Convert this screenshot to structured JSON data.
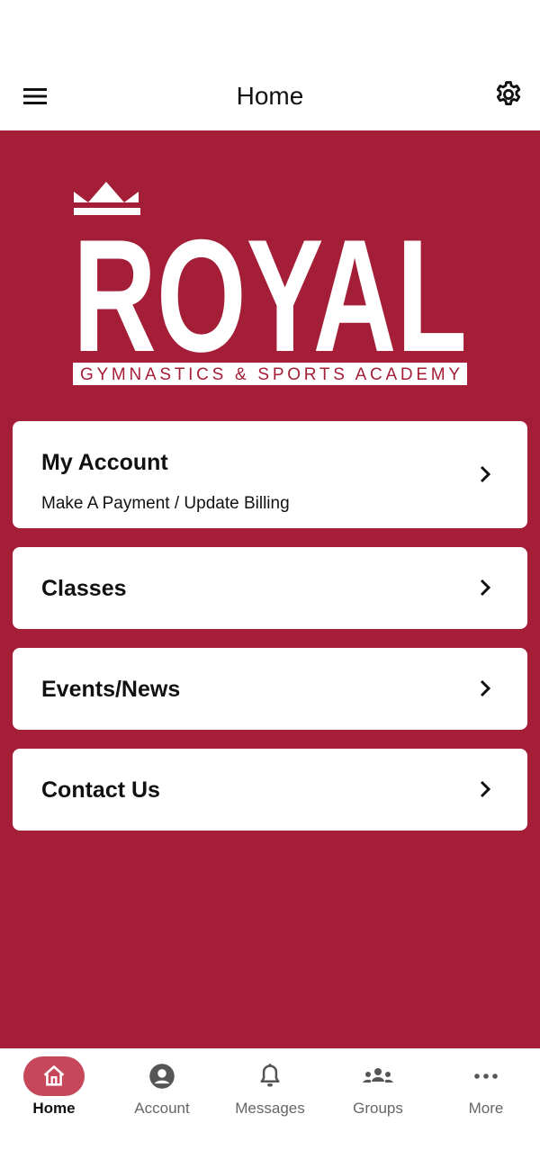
{
  "header": {
    "title": "Home",
    "menu_icon": "hamburger-menu-icon",
    "settings_icon": "gear-icon"
  },
  "logo": {
    "wordmark": "ROYAL",
    "tagline": "GYMNASTICS & SPORTS ACADEMY"
  },
  "cards": {
    "account": {
      "title": "My Account",
      "subtitle": "Make A Payment / Update Billing"
    },
    "classes": {
      "title": "Classes"
    },
    "events": {
      "title": "Events/News"
    },
    "contact": {
      "title": "Contact Us"
    }
  },
  "tabs": [
    {
      "label": "Home",
      "icon": "home-icon",
      "active": true
    },
    {
      "label": "Account",
      "icon": "account-icon",
      "active": false
    },
    {
      "label": "Messages",
      "icon": "bell-icon",
      "active": false
    },
    {
      "label": "Groups",
      "icon": "groups-icon",
      "active": false
    },
    {
      "label": "More",
      "icon": "more-icon",
      "active": false
    }
  ],
  "colors": {
    "brand": "#a51e37",
    "active_tab": "#c6475a"
  }
}
